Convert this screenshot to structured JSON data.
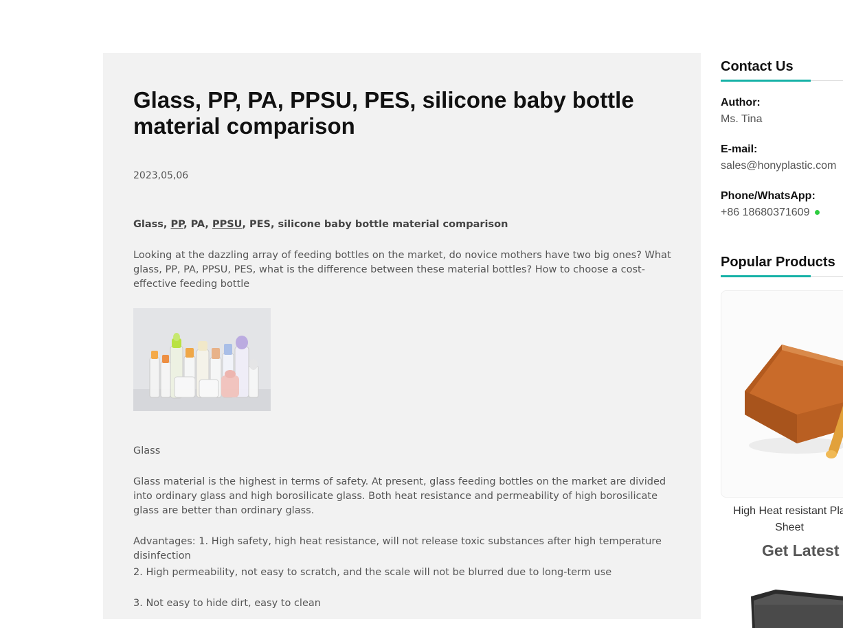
{
  "article": {
    "title": "Glass, PP, PA, PPSU, PES, silicone baby bottle material comparison",
    "date": "2023,05,06",
    "lead_parts": [
      "Glass, ",
      "PP",
      ", PA, ",
      "PPSU",
      ", PES, silicone baby bottle material comparison"
    ],
    "intro": "Looking at the dazzling array of feeding bottles on the market, do novice mothers have two big ones? What glass, PP, PA, PPSU, PES, what is the difference between these material bottles? How to choose a cost-effective feeding bottle",
    "image_alt": "baby bottles",
    "section_heading": "Glass",
    "glass_paragraph": "Glass material is the highest in terms of safety. At present, glass feeding bottles on the market are divided into ordinary glass and high borosilicate glass. Both heat resistance and permeability of high borosilicate glass are better than ordinary glass.",
    "advantage_1": "Advantages: 1. High safety, high heat resistance, will not release toxic substances after high temperature disinfection",
    "advantage_2": "2. High permeability, not easy to scratch, and the scale will not be blurred due to long-term use",
    "advantage_3": "3. Not easy to hide dirt, easy to clean"
  },
  "sidebar": {
    "contact_heading": "Contact Us",
    "author_label": "Author:",
    "author_value": "Ms. Tina",
    "email_label": "E-mail:",
    "email_value": "sales@honyplastic.com",
    "phone_label": "Phone/WhatsApp:",
    "phone_value": "+86 18680371609",
    "popular_heading": "Popular Products",
    "product_name_line1": "High Heat resistant Pla",
    "product_name_line2": "Sheet",
    "get_latest": "Get Latest"
  },
  "colors": {
    "accent": "#16b1a7",
    "article_bg": "#f2f2f2",
    "online": "#2ecc40"
  }
}
